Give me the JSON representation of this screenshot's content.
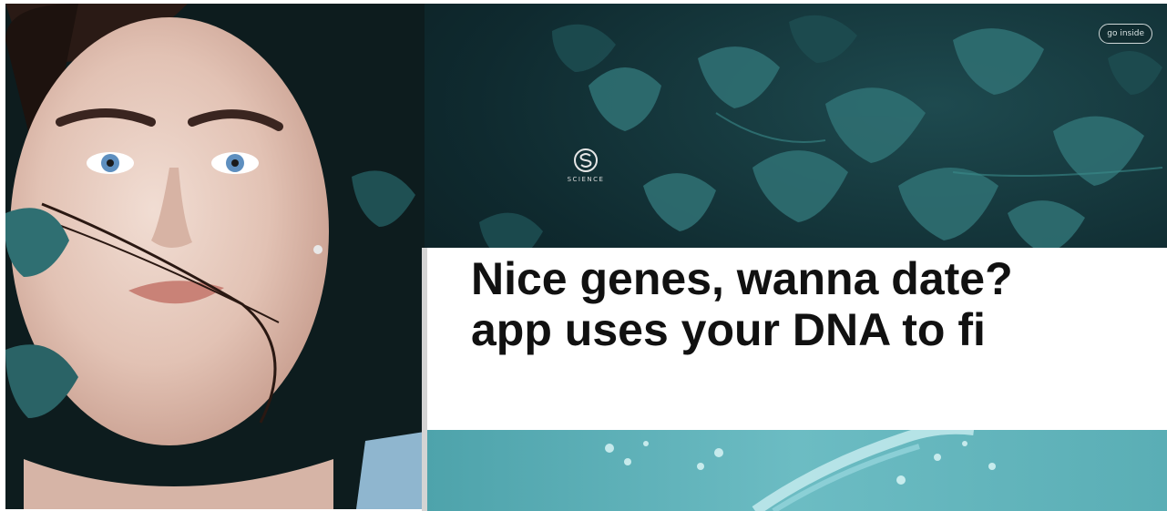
{
  "logo": {
    "icon": "scientific-s-logo-icon",
    "wordmark": "SCIENCE"
  },
  "corner_pill": {
    "label": "go inside"
  },
  "article": {
    "headline_line1": "Nice genes, wanna date?",
    "headline_line2": "app uses your DNA to fi"
  },
  "colors": {
    "ivy_dark": "#0f2a2f",
    "ivy_leaf": "#2e6b6e",
    "dna_teal": "#5fb3ba",
    "card_border": "#d4d4d4"
  }
}
